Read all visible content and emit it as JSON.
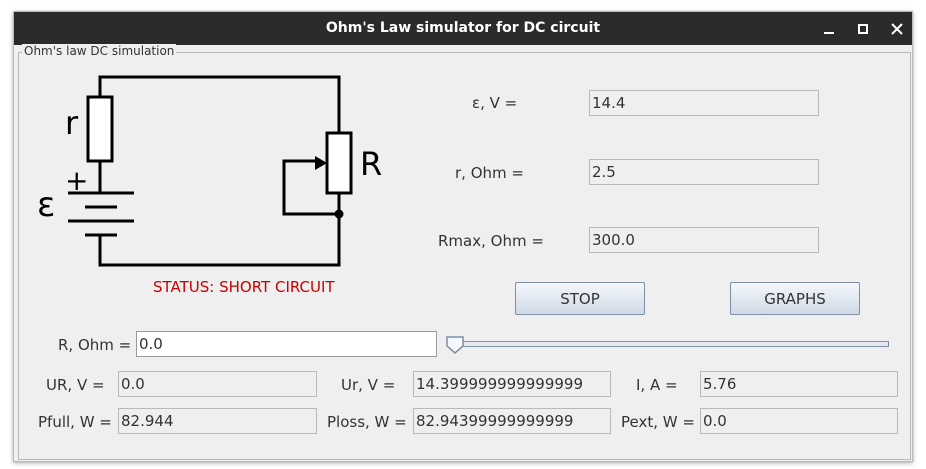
{
  "window": {
    "title": "Ohm's Law simulator for DC circuit"
  },
  "panel": {
    "title": "Ohm's law DC simulation"
  },
  "circuit": {
    "label_r": "r",
    "label_R": "R",
    "label_plus": "+",
    "label_emf": "ε"
  },
  "status": "STATUS: SHORT CIRCUIT",
  "params": {
    "emf_label": "ε, V =",
    "emf_value": "14.4",
    "r_label": "r, Ohm =",
    "r_value": "2.5",
    "rmax_label": "Rmax, Ohm =",
    "rmax_value": "300.0"
  },
  "buttons": {
    "stop": "STOP",
    "graphs": "GRAPHS"
  },
  "load": {
    "label": "R, Ohm =",
    "value": "0.0",
    "slider_fraction": 0.0
  },
  "results": {
    "UR_label": "UR, V =",
    "UR_value": "0.0",
    "Ur_label": "Ur, V =",
    "Ur_value": "14.399999999999999",
    "I_label": "I, A =",
    "I_value": "5.76",
    "Pfull_label": "Pfull, W =",
    "Pfull_value": "82.944",
    "Ploss_label": "Ploss, W =",
    "Ploss_value": "82.94399999999999",
    "Pext_label": "Pext, W =",
    "Pext_value": "0.0"
  }
}
